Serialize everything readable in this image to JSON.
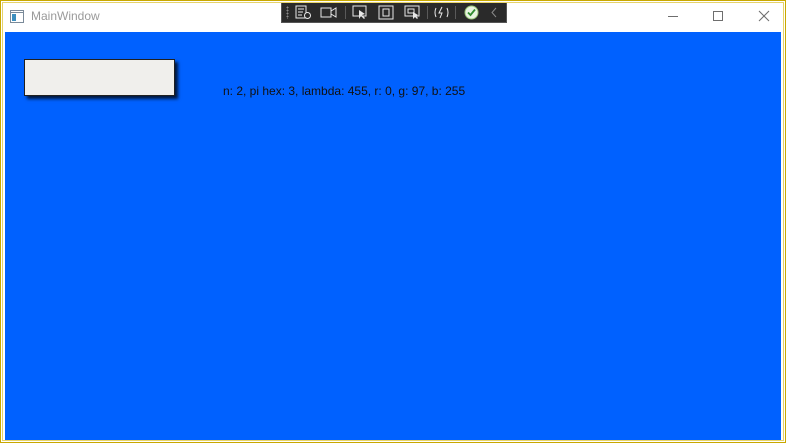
{
  "window": {
    "title": "MainWindow",
    "background_color": "#0061ff",
    "border_color": "#c9a800"
  },
  "caption_buttons": [
    {
      "name": "minimize",
      "icon": "minimize-icon"
    },
    {
      "name": "maximize",
      "icon": "maximize-icon"
    },
    {
      "name": "close",
      "icon": "close-icon"
    }
  ],
  "debug_toolbar": {
    "items": [
      {
        "name": "go-to-live-visual-tree",
        "icon": "visual-tree-icon"
      },
      {
        "name": "show-in-app-toolbar",
        "icon": "video-camera-icon"
      },
      {
        "name": "select-element",
        "icon": "select-element-icon"
      },
      {
        "name": "display-layout-adorners",
        "icon": "layout-adorner-icon"
      },
      {
        "name": "track-focused-element",
        "icon": "track-focus-icon"
      },
      {
        "name": "hot-reload",
        "icon": "hot-reload-icon"
      },
      {
        "name": "binding-status",
        "icon": "check-circle-icon"
      },
      {
        "name": "collapse-toolbar",
        "icon": "chevron-left-icon"
      }
    ]
  },
  "content": {
    "button_label": "",
    "info_text": "n: 2, pi hex: 3, lambda: 455, r: 0, g: 97, b: 255"
  }
}
